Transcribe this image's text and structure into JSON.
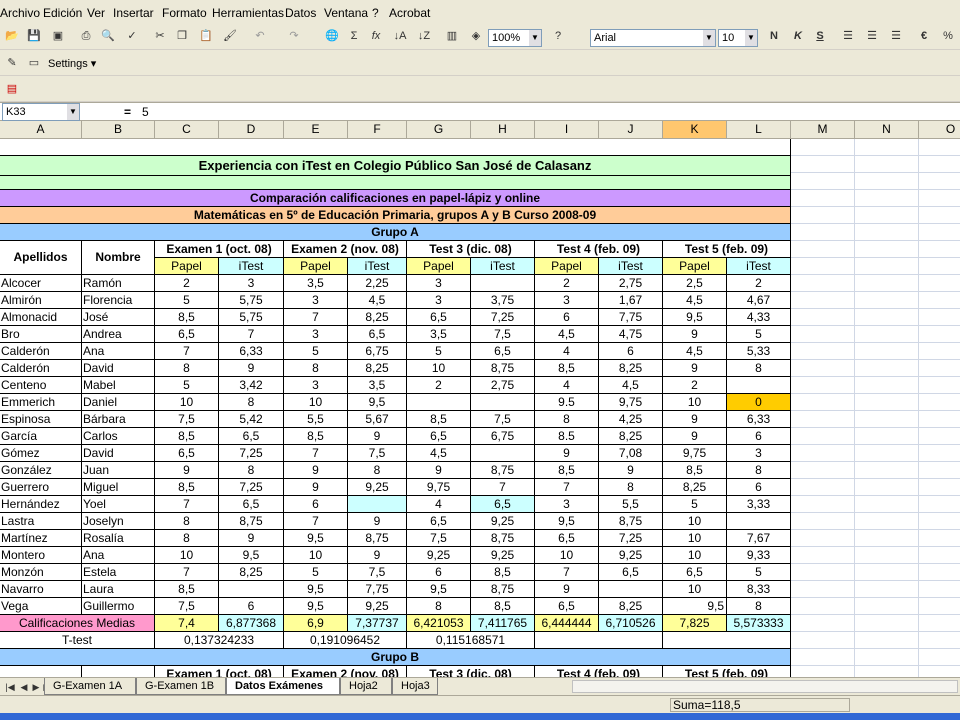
{
  "menu": [
    "Archivo",
    "Edición",
    "Ver",
    "Insertar",
    "Formato",
    "Herramientas",
    "Datos",
    "Ventana",
    "?",
    "Acrobat"
  ],
  "toolbar": {
    "zoom": "100%",
    "font": "Arial",
    "size": "10",
    "bold_label": "N",
    "italic_label": "K",
    "underline_label": "S",
    "currency_label": "€",
    "sum_label": "Σ",
    "fx_label": "fx",
    "settings_label": "Settings"
  },
  "formula_bar": {
    "name_box": "K33",
    "equals": "=",
    "content": "5"
  },
  "columns": [
    "A",
    "B",
    "C",
    "D",
    "E",
    "F",
    "G",
    "H",
    "I",
    "J",
    "K",
    "L",
    "M",
    "N",
    "O"
  ],
  "title": "Experiencia con iTest en Colegio Público San José de Calasanz",
  "subtitle1": "Comparación calificaciones en papel-lápiz y online",
  "subtitle2": "Matemáticas en 5º de Educación Primaria, grupos A y B Curso 2008-09",
  "groupA": "Grupo A",
  "groupB": "Grupo B",
  "headers": {
    "apellidos": "Apellidos",
    "nombre": "Nombre",
    "exams": [
      "Examen 1 (oct. 08)",
      "Examen 2 (nov. 08)",
      "Test 3 (dic. 08)",
      "Test 4 (feb. 09)",
      "Test 5 (feb. 09)"
    ],
    "papel": "Papel",
    "itest": "iTest"
  },
  "rows": [
    {
      "ap": "Alcocer",
      "nom": "Ramón",
      "v": [
        "2",
        "3",
        "3,5",
        "2,25",
        "3",
        "",
        "2",
        "2,75",
        "2,5",
        "2"
      ]
    },
    {
      "ap": "Almirón",
      "nom": "Florencia",
      "v": [
        "5",
        "5,75",
        "3",
        "4,5",
        "3",
        "3,75",
        "3",
        "1,67",
        "4,5",
        "4,67"
      ]
    },
    {
      "ap": "Almonacid",
      "nom": "José",
      "v": [
        "8,5",
        "5,75",
        "7",
        "8,25",
        "6,5",
        "7,25",
        "6",
        "7,75",
        "9,5",
        "4,33"
      ]
    },
    {
      "ap": "Bro",
      "nom": "Andrea",
      "v": [
        "6,5",
        "7",
        "3",
        "6,5",
        "3,5",
        "7,5",
        "4,5",
        "4,75",
        "9",
        "5"
      ]
    },
    {
      "ap": "Calderón",
      "nom": "Ana",
      "v": [
        "7",
        "6,33",
        "5",
        "6,75",
        "5",
        "6,5",
        "4",
        "6",
        "4,5",
        "5,33"
      ]
    },
    {
      "ap": "Calderón",
      "nom": "David",
      "v": [
        "8",
        "9",
        "8",
        "8,25",
        "10",
        "8,75",
        "8,5",
        "8,25",
        "9",
        "8"
      ]
    },
    {
      "ap": "Centeno",
      "nom": "Mabel",
      "v": [
        "5",
        "3,42",
        "3",
        "3,5",
        "2",
        "2,75",
        "4",
        "4,5",
        "2",
        ""
      ]
    },
    {
      "ap": "Emmerich",
      "nom": "Daniel",
      "v": [
        "10",
        "8",
        "10",
        "9,5",
        "",
        "",
        "9.5",
        "9,75",
        "10",
        "0"
      ]
    },
    {
      "ap": "Espinosa",
      "nom": "Bárbara",
      "v": [
        "7,5",
        "5,42",
        "5,5",
        "5,67",
        "8,5",
        "7,5",
        "8",
        "4,25",
        "9",
        "6,33"
      ]
    },
    {
      "ap": "García",
      "nom": "Carlos",
      "v": [
        "8,5",
        "6,5",
        "8,5",
        "9",
        "6,5",
        "6,75",
        "8.5",
        "8,25",
        "9",
        "6"
      ]
    },
    {
      "ap": "Gómez",
      "nom": "David",
      "v": [
        "6,5",
        "7,25",
        "7",
        "7,5",
        "4,5",
        "",
        "9",
        "7,08",
        "9,75",
        "3"
      ]
    },
    {
      "ap": "González",
      "nom": "Juan",
      "v": [
        "9",
        "8",
        "9",
        "8",
        "9",
        "8,75",
        "8,5",
        "9",
        "8,5",
        "8"
      ]
    },
    {
      "ap": "Guerrero",
      "nom": "Miguel",
      "v": [
        "8,5",
        "7,25",
        "9",
        "9,25",
        "9,75",
        "7",
        "7",
        "8",
        "8,25",
        "6"
      ]
    },
    {
      "ap": "Hernández",
      "nom": "Yoel",
      "v": [
        "7",
        "6,5",
        "6",
        "",
        "4",
        "6,5",
        "3",
        "5,5",
        "5",
        "3,33"
      ]
    },
    {
      "ap": "Lastra",
      "nom": "Joselyn",
      "v": [
        "8",
        "8,75",
        "7",
        "9",
        "6,5",
        "9,25",
        "9,5",
        "8,75",
        "10",
        ""
      ]
    },
    {
      "ap": "Martínez",
      "nom": "Rosalía",
      "v": [
        "8",
        "9",
        "9,5",
        "8,75",
        "7,5",
        "8,75",
        "6,5",
        "7,25",
        "10",
        "7,67"
      ]
    },
    {
      "ap": "Montero",
      "nom": "Ana",
      "v": [
        "10",
        "9,5",
        "10",
        "9",
        "9,25",
        "9,25",
        "10",
        "9,25",
        "10",
        "9,33"
      ]
    },
    {
      "ap": "Monzón",
      "nom": "Estela",
      "v": [
        "7",
        "8,25",
        "5",
        "7,5",
        "6",
        "8,5",
        "7",
        "6,5",
        "6,5",
        "5"
      ]
    },
    {
      "ap": "Navarro",
      "nom": "Laura",
      "v": [
        "8,5",
        "",
        "9,5",
        "7,75",
        "9,5",
        "8,75",
        "9",
        "",
        "10",
        "8,33"
      ]
    },
    {
      "ap": "Vega",
      "nom": "Guillermo",
      "v": [
        "7,5",
        "6",
        "9,5",
        "9,25",
        "8",
        "8,5",
        "6,5",
        "8,25",
        "9,5",
        "8"
      ]
    }
  ],
  "medias": {
    "label": "Calificaciones Medias",
    "v": [
      "7,4",
      "6,877368",
      "6,9",
      "7,37737",
      "6,421053",
      "7,411765",
      "6,444444",
      "6,710526",
      "7,825",
      "5,573333"
    ]
  },
  "ttest": {
    "label": "T-test",
    "v": [
      "0,137324233",
      "0,191096452",
      "0,115168571"
    ]
  },
  "sheet_tabs": [
    "G-Examen 1A",
    "G-Examen 1B",
    "Datos Exámenes",
    "Hoja2",
    "Hoja3"
  ],
  "status": {
    "sum": "Suma=118,5"
  },
  "colors": {
    "title_bg": "#ccffcc",
    "sub1_bg": "#cc99ff",
    "sub2_bg": "#ffcc99",
    "group_bg": "#99ccff",
    "papel_bg": "#ffff99",
    "itest_bg": "#ccffff",
    "medias_bg": "#ff99cc",
    "highlight": "#ffcc00"
  }
}
